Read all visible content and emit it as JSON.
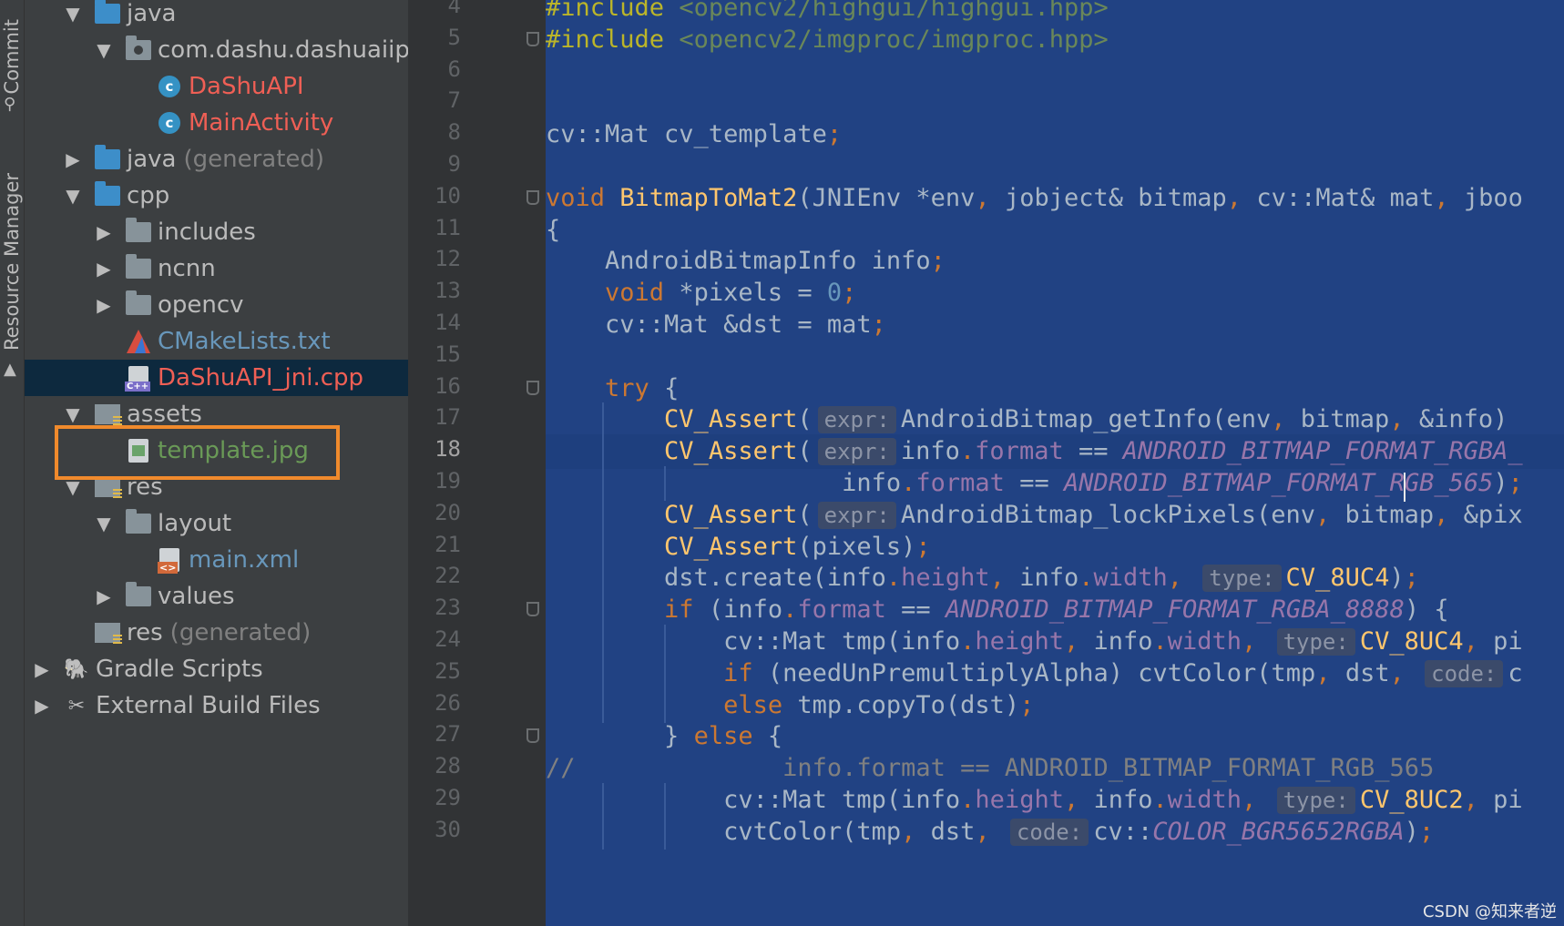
{
  "toolwindow_strip": [
    {
      "id": "commit",
      "label": "Commit",
      "icon": "commit-icon"
    },
    {
      "id": "resource_manager",
      "label": "Resource Manager",
      "icon": "resource-manager-icon"
    }
  ],
  "project_tree": [
    {
      "label": "java",
      "expand": "open",
      "icon": "folder-blue",
      "color": "#bbbbbb"
    },
    {
      "label": "com.dashu.dashuaiip",
      "expand": "open",
      "icon": "package",
      "color": "#bbbbbb"
    },
    {
      "label": "DaShuAPI",
      "expand": "none",
      "icon": "class",
      "color": "#ef5f55"
    },
    {
      "label": "MainActivity",
      "expand": "none",
      "icon": "class",
      "color": "#ef5f55"
    },
    {
      "label": "java",
      "suffix": "(generated)",
      "expand": "closed",
      "icon": "folder-generated",
      "color": "#bbbbbb"
    },
    {
      "label": "cpp",
      "expand": "open",
      "icon": "folder-blue",
      "color": "#bbbbbb"
    },
    {
      "label": "includes",
      "expand": "closed",
      "icon": "folder",
      "color": "#bbbbbb"
    },
    {
      "label": "ncnn",
      "expand": "closed",
      "icon": "folder",
      "color": "#bbbbbb"
    },
    {
      "label": "opencv",
      "expand": "closed",
      "icon": "folder",
      "color": "#bbbbbb"
    },
    {
      "label": "CMakeLists.txt",
      "expand": "none",
      "icon": "cmake",
      "color": "#6897bb"
    },
    {
      "label": "DaShuAPI_jni.cpp",
      "expand": "none",
      "icon": "cpp-file",
      "color": "#ef5f55",
      "selected": true
    },
    {
      "label": "assets",
      "expand": "open",
      "icon": "folder-res",
      "color": "#bbbbbb"
    },
    {
      "label": "template.jpg",
      "expand": "none",
      "icon": "image-file",
      "color": "#6a9a57",
      "highlighted": true
    },
    {
      "label": "res",
      "expand": "open",
      "icon": "folder-res",
      "color": "#bbbbbb"
    },
    {
      "label": "layout",
      "expand": "open",
      "icon": "folder",
      "color": "#bbbbbb"
    },
    {
      "label": "main.xml",
      "expand": "none",
      "icon": "xml-file",
      "color": "#6897bb"
    },
    {
      "label": "values",
      "expand": "closed",
      "icon": "folder",
      "color": "#bbbbbb"
    },
    {
      "label": "res",
      "suffix": "(generated)",
      "expand": "none",
      "icon": "folder-res",
      "color": "#bbbbbb"
    },
    {
      "label": "Gradle Scripts",
      "expand": "closed",
      "icon": "gradle-icon",
      "color": "#bbbbbb"
    },
    {
      "label": "External Build Files",
      "expand": "closed",
      "icon": "build-tools-icon",
      "color": "#bbbbbb"
    }
  ],
  "editor": {
    "current_line": "18",
    "lines": [
      {
        "n": "4",
        "t": [
          [
            "pp",
            "#include "
          ],
          [
            "s",
            "<opencv2/highgui/highgui.hpp>"
          ]
        ]
      },
      {
        "n": "5",
        "t": [
          [
            "pp",
            "#include "
          ],
          [
            "s",
            "<opencv2/imgproc/imgproc.hpp>"
          ]
        ]
      },
      {
        "n": "6",
        "t": []
      },
      {
        "n": "7",
        "t": []
      },
      {
        "n": "8",
        "t": [
          [
            "p",
            "cv::Mat cv_template"
          ],
          [
            "k",
            ";"
          ]
        ]
      },
      {
        "n": "9",
        "t": []
      },
      {
        "n": "10",
        "t": [
          [
            "k",
            "void "
          ],
          [
            "f",
            "BitmapToMat2"
          ],
          [
            "p",
            "(JNIEnv *env"
          ],
          [
            "k",
            ", "
          ],
          [
            "p",
            "jobject& bitmap"
          ],
          [
            "k",
            ", "
          ],
          [
            "p",
            "cv::Mat& mat"
          ],
          [
            "k",
            ", "
          ],
          [
            "p",
            "jboo"
          ]
        ]
      },
      {
        "n": "11",
        "t": [
          [
            "p",
            "{"
          ]
        ]
      },
      {
        "n": "12",
        "t": [
          [
            "p",
            "    AndroidBitmapInfo info"
          ],
          [
            "k",
            ";"
          ]
        ]
      },
      {
        "n": "13",
        "t": [
          [
            "p",
            "    "
          ],
          [
            "k",
            "void "
          ],
          [
            "p",
            "*pixels = "
          ],
          [
            "nu",
            "0"
          ],
          [
            "k",
            ";"
          ]
        ]
      },
      {
        "n": "14",
        "t": [
          [
            "p",
            "    cv::Mat &dst = mat"
          ],
          [
            "k",
            ";"
          ]
        ]
      },
      {
        "n": "15",
        "t": []
      },
      {
        "n": "16",
        "t": [
          [
            "p",
            "    "
          ],
          [
            "k",
            "try "
          ],
          [
            "p",
            "{"
          ]
        ]
      },
      {
        "n": "17",
        "t": [
          [
            "p",
            "        "
          ],
          [
            "m",
            "CV_Assert"
          ],
          [
            "p",
            "("
          ],
          [
            "h",
            "expr:"
          ],
          [
            "p",
            "AndroidBitmap_getInfo(env"
          ],
          [
            "k",
            ", "
          ],
          [
            "p",
            "bitmap"
          ],
          [
            "k",
            ", "
          ],
          [
            "p",
            "&info)"
          ]
        ]
      },
      {
        "n": "18",
        "t": [
          [
            "p",
            "        "
          ],
          [
            "m",
            "CV_Assert"
          ],
          [
            "p",
            "("
          ],
          [
            "h",
            "expr:"
          ],
          [
            "p",
            "info"
          ],
          [
            "k",
            "."
          ],
          [
            "pu",
            "format"
          ],
          [
            "p",
            " == "
          ],
          [
            "it",
            "ANDROID_BITMAP_FORMAT_RGBA_"
          ]
        ]
      },
      {
        "n": "19",
        "t": [
          [
            "p",
            "                    info"
          ],
          [
            "k",
            "."
          ],
          [
            "pu",
            "format"
          ],
          [
            "p",
            " == "
          ],
          [
            "it",
            "ANDROID_BITMAP_FORMAT_RGB_565"
          ],
          [
            "p",
            ")"
          ],
          [
            "k",
            ";"
          ]
        ]
      },
      {
        "n": "20",
        "t": [
          [
            "p",
            "        "
          ],
          [
            "m",
            "CV_Assert"
          ],
          [
            "p",
            "("
          ],
          [
            "h",
            "expr:"
          ],
          [
            "p",
            "AndroidBitmap_lockPixels(env"
          ],
          [
            "k",
            ", "
          ],
          [
            "p",
            "bitmap"
          ],
          [
            "k",
            ", "
          ],
          [
            "p",
            "&pix"
          ]
        ]
      },
      {
        "n": "21",
        "t": [
          [
            "p",
            "        "
          ],
          [
            "m",
            "CV_Assert"
          ],
          [
            "p",
            "(pixels)"
          ],
          [
            "k",
            ";"
          ]
        ]
      },
      {
        "n": "22",
        "t": [
          [
            "p",
            "        dst.create(info"
          ],
          [
            "k",
            "."
          ],
          [
            "pu",
            "height"
          ],
          [
            "k",
            ", "
          ],
          [
            "p",
            "info"
          ],
          [
            "k",
            "."
          ],
          [
            "pu",
            "width"
          ],
          [
            "k",
            ", "
          ],
          [
            "h",
            "type:"
          ],
          [
            "m",
            "CV_8UC4"
          ],
          [
            "p",
            ")"
          ],
          [
            "k",
            ";"
          ]
        ]
      },
      {
        "n": "23",
        "t": [
          [
            "p",
            "        "
          ],
          [
            "k",
            "if "
          ],
          [
            "p",
            "(info"
          ],
          [
            "k",
            "."
          ],
          [
            "pu",
            "format"
          ],
          [
            "p",
            " == "
          ],
          [
            "it",
            "ANDROID_BITMAP_FORMAT_RGBA_8888"
          ],
          [
            "p",
            ") {"
          ]
        ]
      },
      {
        "n": "24",
        "t": [
          [
            "p",
            "            cv::Mat tmp(info"
          ],
          [
            "k",
            "."
          ],
          [
            "pu",
            "height"
          ],
          [
            "k",
            ", "
          ],
          [
            "p",
            "info"
          ],
          [
            "k",
            "."
          ],
          [
            "pu",
            "width"
          ],
          [
            "k",
            ", "
          ],
          [
            "h",
            "type:"
          ],
          [
            "m",
            "CV_8UC4"
          ],
          [
            "k",
            ", "
          ],
          [
            "p",
            "pi"
          ]
        ]
      },
      {
        "n": "25",
        "t": [
          [
            "p",
            "            "
          ],
          [
            "k",
            "if "
          ],
          [
            "p",
            "(needUnPremultiplyAlpha) cvtColor(tmp"
          ],
          [
            "k",
            ", "
          ],
          [
            "p",
            "dst"
          ],
          [
            "k",
            ", "
          ],
          [
            "h",
            "code:"
          ],
          [
            "p",
            "c"
          ]
        ]
      },
      {
        "n": "26",
        "t": [
          [
            "p",
            "            "
          ],
          [
            "k",
            "else "
          ],
          [
            "p",
            "tmp.copyTo(dst)"
          ],
          [
            "k",
            ";"
          ]
        ]
      },
      {
        "n": "27",
        "t": [
          [
            "p",
            "        } "
          ],
          [
            "k",
            "else "
          ],
          [
            "p",
            "{"
          ]
        ]
      },
      {
        "n": "28",
        "t": [
          [
            "cm",
            "//              info.format == ANDROID_BITMAP_FORMAT_RGB_565"
          ]
        ]
      },
      {
        "n": "29",
        "t": [
          [
            "p",
            "            cv::Mat tmp(info"
          ],
          [
            "k",
            "."
          ],
          [
            "pu",
            "height"
          ],
          [
            "k",
            ", "
          ],
          [
            "p",
            "info"
          ],
          [
            "k",
            "."
          ],
          [
            "pu",
            "width"
          ],
          [
            "k",
            ", "
          ],
          [
            "h",
            "type:"
          ],
          [
            "m",
            "CV_8UC2"
          ],
          [
            "k",
            ", "
          ],
          [
            "p",
            "pi"
          ]
        ]
      },
      {
        "n": "30",
        "t": [
          [
            "p",
            "            cvtColor(tmp"
          ],
          [
            "k",
            ", "
          ],
          [
            "p",
            "dst"
          ],
          [
            "k",
            ", "
          ],
          [
            "h",
            "code:"
          ],
          [
            "p",
            "cv::"
          ],
          [
            "it",
            "COLOR_BGR5652RGBA"
          ],
          [
            "p",
            ")"
          ],
          [
            "k",
            ";"
          ]
        ]
      }
    ]
  },
  "watermark": "CSDN @知来者逆",
  "colors": {
    "editor_bg": "#214283",
    "highlight_box": "#f08a2c",
    "selected_row": "#0d293e"
  }
}
